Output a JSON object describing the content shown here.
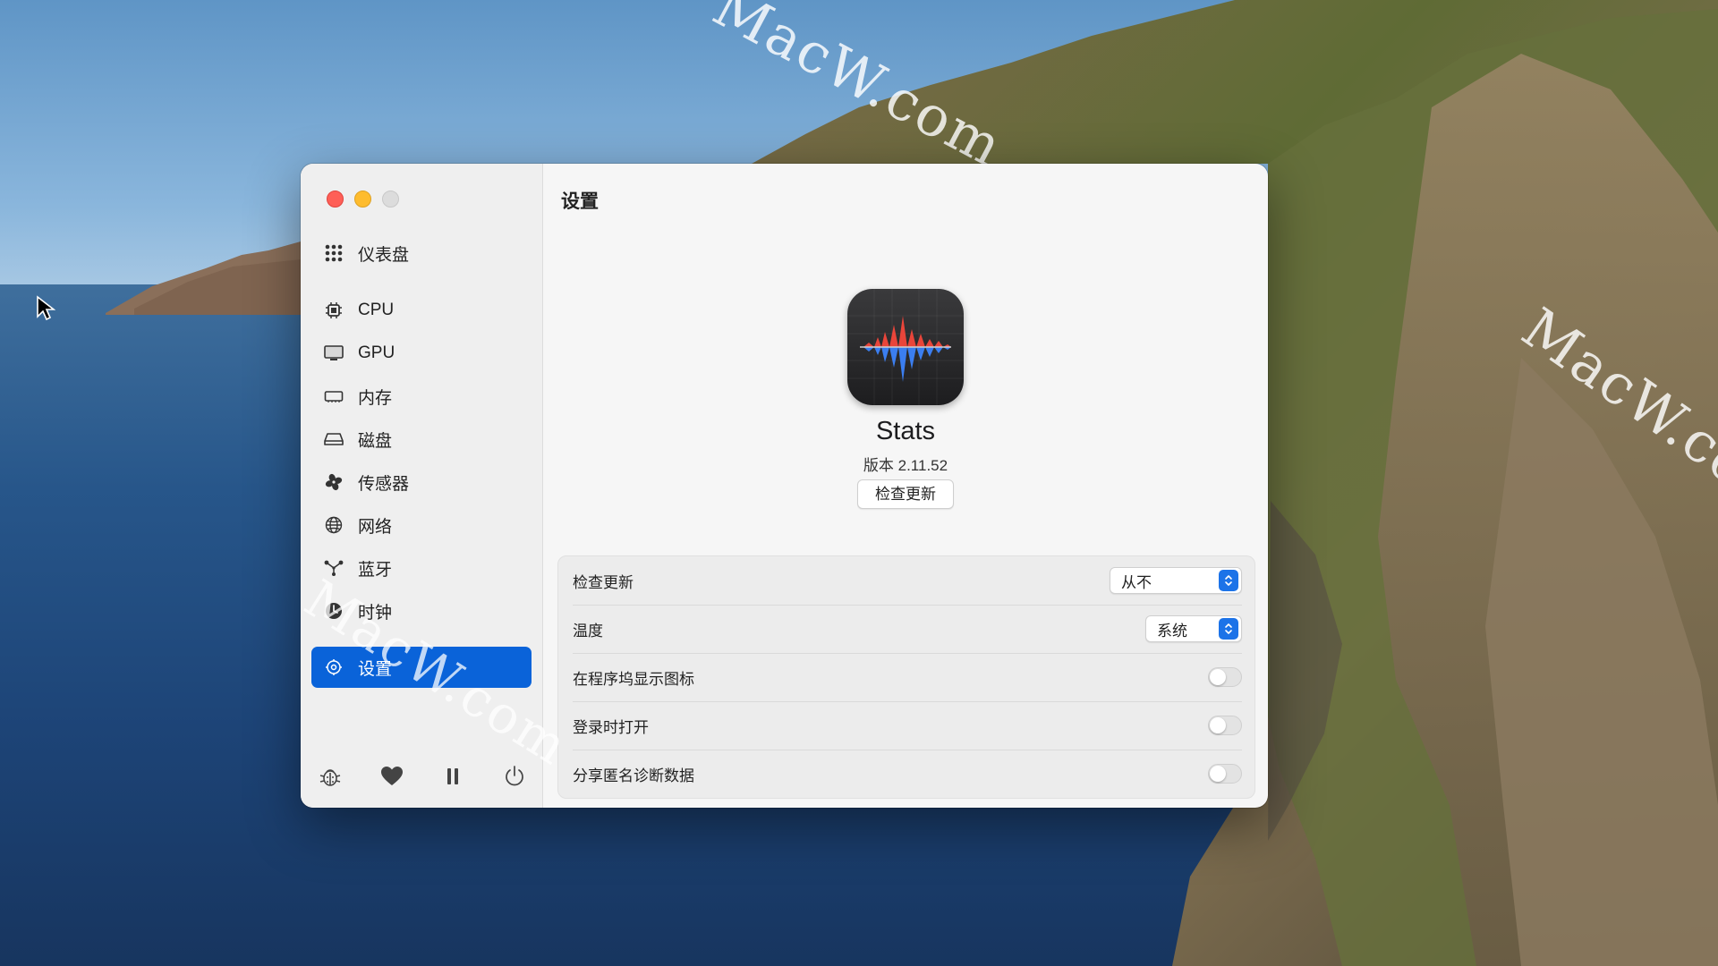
{
  "window": {
    "title": "设置"
  },
  "sidebar": {
    "items": [
      {
        "label": "仪表盘",
        "icon": "dashboard-grid-icon"
      },
      {
        "label": "CPU",
        "icon": "cpu-chip-icon"
      },
      {
        "label": "GPU",
        "icon": "display-icon"
      },
      {
        "label": "内存",
        "icon": "memory-icon"
      },
      {
        "label": "磁盘",
        "icon": "disk-icon"
      },
      {
        "label": "传感器",
        "icon": "fan-icon"
      },
      {
        "label": "网络",
        "icon": "globe-icon"
      },
      {
        "label": "蓝牙",
        "icon": "bluetooth-nodes-icon"
      },
      {
        "label": "时钟",
        "icon": "clock-icon"
      },
      {
        "label": "设置",
        "icon": "gear-icon",
        "selected": true
      }
    ],
    "footer_icons": [
      "bug-icon",
      "heart-icon",
      "pause-icon",
      "power-icon"
    ]
  },
  "about": {
    "app_name": "Stats",
    "version": "版本 2.11.52",
    "check_button": "检查更新"
  },
  "settings": {
    "update_label": "检查更新",
    "update_value": "从不",
    "temperature_label": "温度",
    "temperature_value": "系统",
    "dock_icon_label": "在程序坞显示图标",
    "dock_icon_on": false,
    "login_label": "登录时打开",
    "login_on": false,
    "diagnostics_label": "分享匿名诊断数据",
    "diagnostics_on": false
  },
  "watermarks": [
    "MacW.com",
    "MacW.com",
    "MacW.com"
  ],
  "colors": {
    "accent": "#0a63d9",
    "close": "#fe5f57",
    "minimize": "#febc2e",
    "wave_red": "#e9453a",
    "wave_blue": "#3b7ef0"
  }
}
